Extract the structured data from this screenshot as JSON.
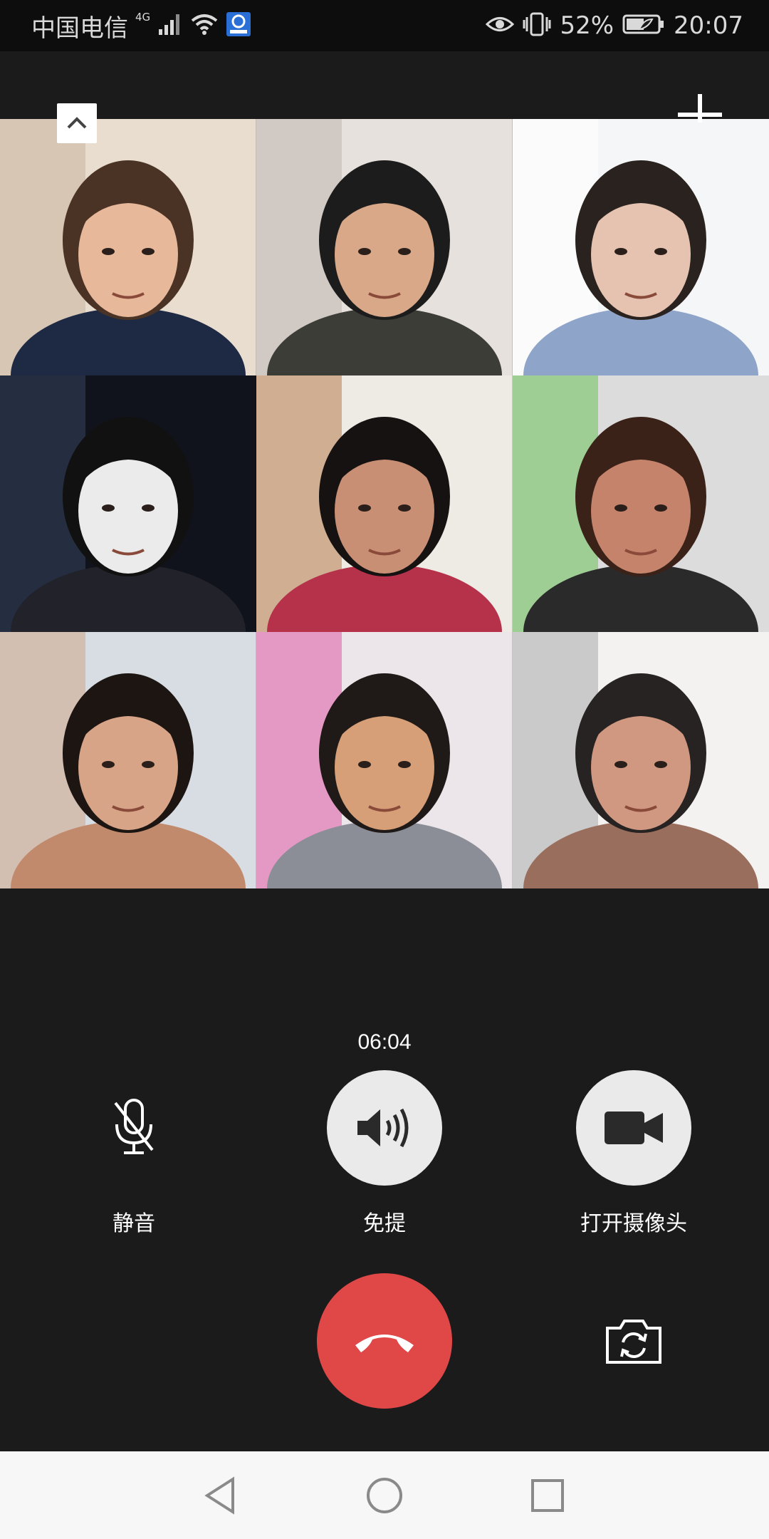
{
  "status_bar": {
    "carrier": "中国电信",
    "network_type": "4G",
    "battery_percent": "52%",
    "time": "20:07",
    "icons": [
      "signal-icon",
      "wifi-icon",
      "app-notification-icon",
      "eye-comfort-icon",
      "vibrate-icon",
      "battery-icon"
    ]
  },
  "call": {
    "duration": "06:04",
    "controls": [
      {
        "name": "mute",
        "label": "静音",
        "icon": "mic-off-icon"
      },
      {
        "name": "hands-free",
        "label": "免提",
        "icon": "speaker-icon"
      },
      {
        "name": "camera",
        "label": "打开摄像头",
        "icon": "video-camera-icon"
      }
    ],
    "hangup_icon": "hang-up-icon",
    "switch_camera_icon": "switch-camera-icon"
  },
  "video_tiles": [
    {
      "bg": "#e9ddd0",
      "accent": "#c9b29b",
      "skin": "#e8b89a",
      "hair": "#4a3324",
      "clothing": "#1e2a44"
    },
    {
      "bg": "#e6e1dd",
      "accent": "#bfb6ae",
      "skin": "#d9a888",
      "hair": "#1c1c1c",
      "clothing": "#3d3d38"
    },
    {
      "bg": "#f5f6f8",
      "accent": "#ffffff",
      "skin": "#e5c3b0",
      "hair": "#2a221e",
      "clothing": "#8ea4c9"
    },
    {
      "bg": "#10131c",
      "accent": "#37465e",
      "skin": "#ebebec",
      "hair": "#111111",
      "clothing": "#22232a"
    },
    {
      "bg": "#eeeae4",
      "accent": "#b87c4e",
      "skin": "#c98f74",
      "hair": "#161212",
      "clothing": "#b5324a"
    },
    {
      "bg": "#dcdcdc",
      "accent": "#6ec25a",
      "skin": "#c5836c",
      "hair": "#3a2218",
      "clothing": "#2a2a2a"
    },
    {
      "bg": "#d8dde3",
      "accent": "#cfa48b",
      "skin": "#d8a487",
      "hair": "#1c1512",
      "clothing": "#c18a6c"
    },
    {
      "bg": "#ece6ea",
      "accent": "#de5aa6",
      "skin": "#d69f78",
      "hair": "#1f1a18",
      "clothing": "#8b8e96"
    },
    {
      "bg": "#f3f2f1",
      "accent": "#a9a9a9",
      "skin": "#d19881",
      "hair": "#262322",
      "clothing": "#9a6e5c"
    }
  ],
  "top_controls": {
    "collapse_icon": "chevron-up-icon",
    "add_icon": "add-participant-icon"
  },
  "nav_bar": {
    "icons": [
      "back-icon",
      "home-icon",
      "recents-icon"
    ]
  }
}
